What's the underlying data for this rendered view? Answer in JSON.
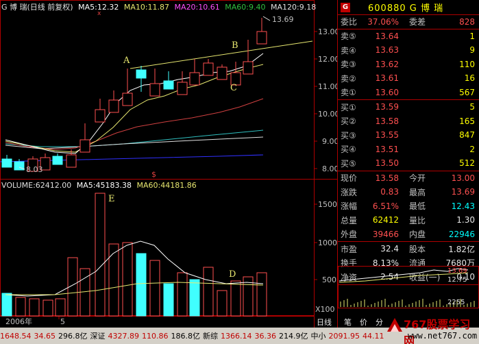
{
  "header": {
    "name": "G 博  瑞(日线 前复权)",
    "ma5": "MA5:12.32",
    "ma10": "MA10:11.87",
    "ma20": "MA20:10.61",
    "ma60": "MA60:9.40",
    "ma120": "MA120:9.18",
    "high_mark": "13.69",
    "low_mark": "8.03",
    "price_axis": [
      "13.00",
      "12.00",
      "11.00",
      "10.00",
      "9.00",
      "8.00"
    ],
    "annotations": [
      "A",
      "B",
      "C"
    ],
    "dollar_mark": "$"
  },
  "volume": {
    "vol": "VOLUME:62412.00",
    "ma5": "MA5:45183.38",
    "ma60": "MA60:44181.86",
    "axis": [
      "1500",
      "1000",
      "500"
    ],
    "unit": "X100",
    "annotations": [
      "E",
      "D"
    ]
  },
  "time_axis": {
    "year": "2006年",
    "month": "5"
  },
  "tabs": [
    "日线",
    "笔",
    "价",
    "分"
  ],
  "panel": {
    "g_badge": "G",
    "title": "600880 G 博  瑞",
    "weibi": {
      "label": "委比",
      "value": "37.06%",
      "label2": "委差",
      "value2": "828"
    },
    "sells": [
      {
        "label": "卖⑤",
        "price": "13.64",
        "vol": "1"
      },
      {
        "label": "卖④",
        "price": "13.63",
        "vol": "9"
      },
      {
        "label": "卖③",
        "price": "13.62",
        "vol": "110"
      },
      {
        "label": "卖②",
        "price": "13.61",
        "vol": "16"
      },
      {
        "label": "卖①",
        "price": "13.60",
        "vol": "567"
      }
    ],
    "buys": [
      {
        "label": "买①",
        "price": "13.59",
        "vol": "5"
      },
      {
        "label": "买②",
        "price": "13.58",
        "vol": "165"
      },
      {
        "label": "买③",
        "price": "13.55",
        "vol": "847"
      },
      {
        "label": "买④",
        "price": "13.51",
        "vol": "2"
      },
      {
        "label": "买⑤",
        "price": "13.50",
        "vol": "512"
      }
    ],
    "quote": [
      {
        "l1": "现价",
        "v1": "13.58",
        "l2": "今开",
        "v2": "13.00"
      },
      {
        "l1": "涨跌",
        "v1": "0.83",
        "l2": "最高",
        "v2": "13.69"
      },
      {
        "l1": "涨幅",
        "v1": "6.51%",
        "l2": "最低",
        "v2": "12.43"
      },
      {
        "l1": "总量",
        "v1": "62412",
        "l2": "量比",
        "v2": "1.30"
      },
      {
        "l1": "外盘",
        "v1": "39466",
        "l2": "内盘",
        "v2": "22946"
      }
    ],
    "fund": [
      {
        "l1": "市盈",
        "v1": "32.4",
        "l2": "股本",
        "v2": "1.82亿"
      },
      {
        "l1": "换手",
        "v1": "8.13%",
        "l2": "流通",
        "v2": "7680万"
      },
      {
        "l1": "净资",
        "v1": "2.54",
        "l2": "收益(一)",
        "v2": "0.10"
      }
    ],
    "mini": {
      "p1": "13.69",
      "p2": "12.75",
      "v": "2255"
    }
  },
  "statusbar": [
    {
      "name": "1648.54",
      "chg": "34.65",
      "amt": "296.8亿"
    },
    {
      "name": "深证",
      "val": "4327.89",
      "chg": "110.86",
      "amt": "186.8亿"
    },
    {
      "name": "新综",
      "val": "1366.14",
      "chg": "36.36",
      "amt": "214.9亿"
    },
    {
      "name": "中小",
      "val": "2091.95",
      "chg": "44.11"
    }
  ],
  "watermark": {
    "text": "767股票学习网",
    "url": "www.net767.com"
  }
}
